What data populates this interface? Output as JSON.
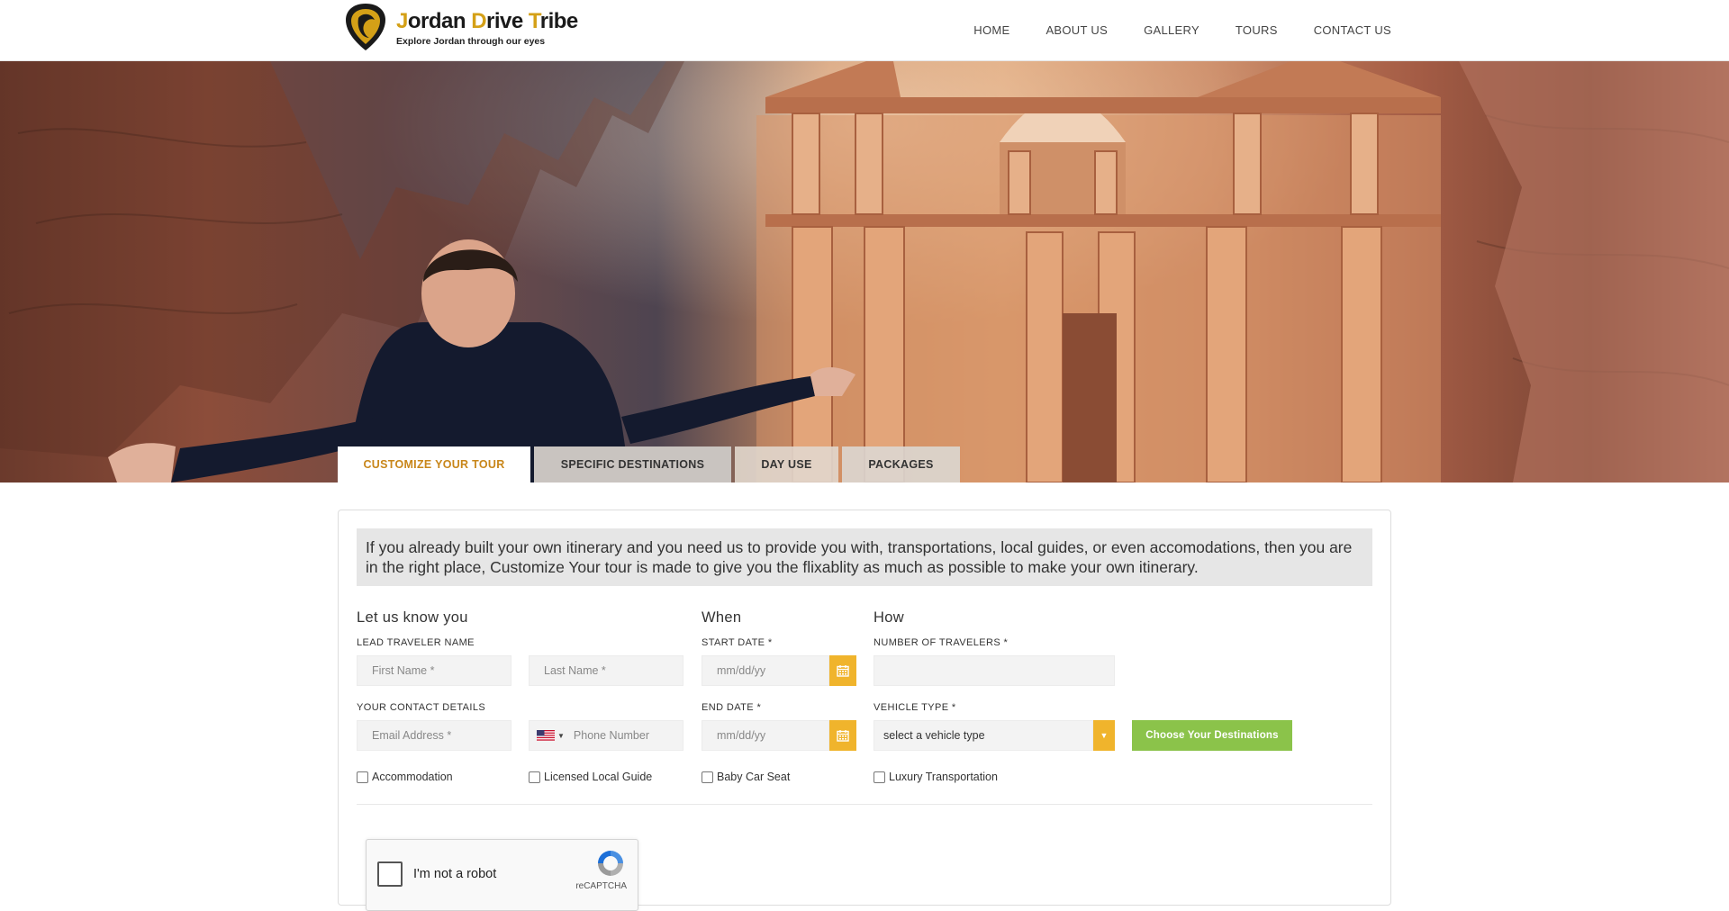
{
  "brand": {
    "title_parts": [
      {
        "text": "J",
        "hl": true
      },
      {
        "text": "ordan ",
        "hl": false
      },
      {
        "text": "D",
        "hl": true
      },
      {
        "text": "rive ",
        "hl": false
      },
      {
        "text": "T",
        "hl": true
      },
      {
        "text": "ribe",
        "hl": false
      }
    ],
    "tagline": "Explore Jordan through our eyes",
    "accent": "#d4a017"
  },
  "nav": {
    "items": [
      "HOME",
      "ABOUT US",
      "GALLERY",
      "TOURS",
      "CONTACT US"
    ]
  },
  "tabs": [
    "CUSTOMIZE YOUR TOUR",
    "SPECIFIC DESTINATIONS",
    "DAY USE",
    "PACKAGES"
  ],
  "intro": "If you already built your own itinerary and you need us to provide you with, transportations, local guides, or even accomodations, then you are in the right place, Customize Your tour is made to give you the flixablity as much as possible to make your own itinerary.",
  "form": {
    "section_know": "Let us know you",
    "section_when": "When",
    "section_how": "How",
    "lead_label": "LEAD TRAVELER NAME",
    "first_name_ph": "First Name *",
    "last_name_ph": "Last Name *",
    "contact_label": "YOUR CONTACT DETAILS",
    "email_ph": "Email Address *",
    "phone_ph": "Phone Number",
    "start_label": "START DATE *",
    "start_ph": "mm/dd/yy",
    "end_label": "END DATE *",
    "end_ph": "mm/dd/yy",
    "travelers_label": "NUMBER OF TRAVELERS *",
    "vehicle_label": "VEHICLE TYPE *",
    "vehicle_value": "select a vehicle type",
    "choose_button": "Choose Your Destinations",
    "checkboxes": [
      "Accommodation",
      "Licensed Local Guide",
      "Baby Car Seat",
      "Luxury Transportation"
    ]
  },
  "captcha": {
    "label": "I'm not a robot",
    "brand": "reCAPTCHA"
  },
  "colors": {
    "accent_orange": "#f0b42c",
    "tab_active_text": "#c8861a",
    "button_green": "#8bc34a"
  }
}
